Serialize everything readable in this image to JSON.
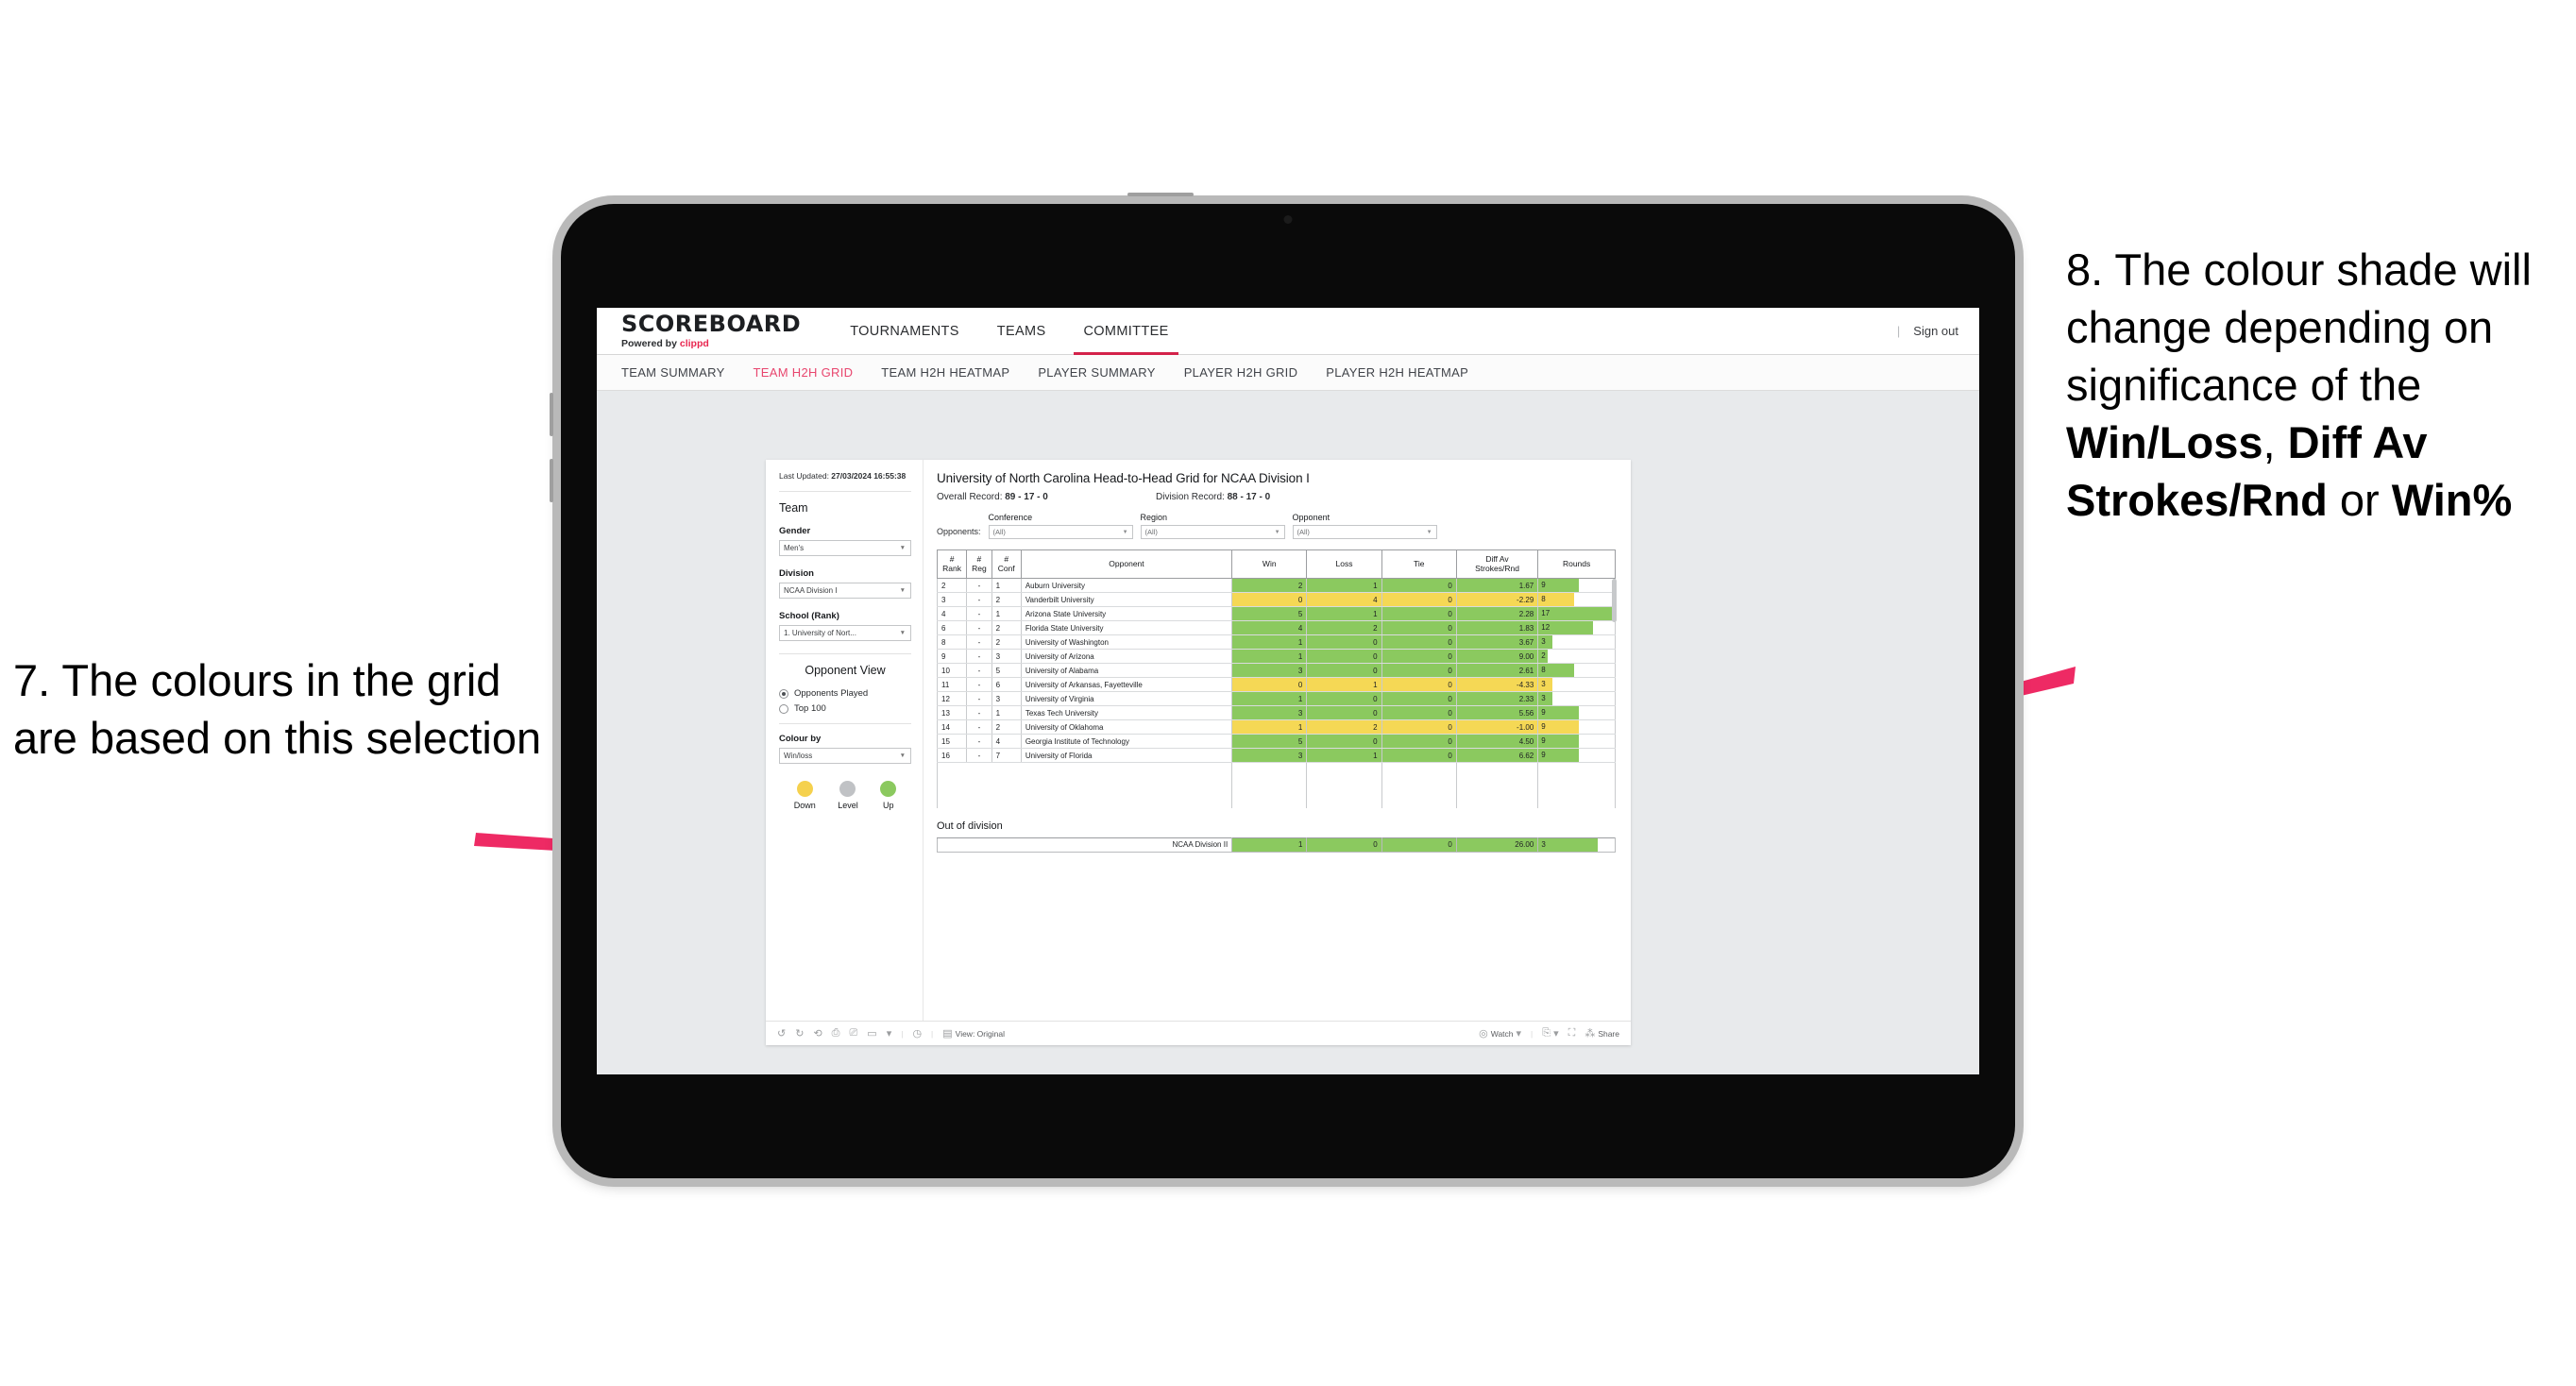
{
  "annotations": {
    "left": "7. The colours in the grid are based on this selection",
    "right_part1": "8. The colour shade will change depending on significance of the ",
    "right_bold1": "Win/Loss",
    "right_mid1": ", ",
    "right_bold2": "Diff Av Strokes/Rnd",
    "right_mid2": " or ",
    "right_bold3": "Win%",
    "arrow_color": "#ee2a64"
  },
  "app": {
    "logo": {
      "main": "SCOREBOARD",
      "sub_prefix": "Powered by ",
      "sub_brand": "clippd"
    },
    "nav": [
      {
        "label": "TOURNAMENTS",
        "active": false
      },
      {
        "label": "TEAMS",
        "active": false
      },
      {
        "label": "COMMITTEE",
        "active": true
      }
    ],
    "sign_out": "Sign out",
    "subnav": [
      {
        "label": "TEAM SUMMARY",
        "active": false
      },
      {
        "label": "TEAM H2H GRID",
        "active": true
      },
      {
        "label": "TEAM H2H HEATMAP",
        "active": false
      },
      {
        "label": "PLAYER SUMMARY",
        "active": false
      },
      {
        "label": "PLAYER H2H GRID",
        "active": false
      },
      {
        "label": "PLAYER H2H HEATMAP",
        "active": false
      }
    ]
  },
  "sidebar": {
    "last_updated_label": "Last Updated: ",
    "last_updated_value": "27/03/2024 16:55:38",
    "team_heading": "Team",
    "gender_label": "Gender",
    "gender_value": "Men's",
    "division_label": "Division",
    "division_value": "NCAA Division I",
    "school_label": "School (Rank)",
    "school_value": "1. University of Nort...",
    "opponent_view_heading": "Opponent View",
    "opponent_view_options": [
      {
        "label": "Opponents Played",
        "selected": true
      },
      {
        "label": "Top 100",
        "selected": false
      }
    ],
    "colour_by_label": "Colour by",
    "colour_by_value": "Win/loss",
    "legend": [
      {
        "label": "Down",
        "color": "#f5d14e"
      },
      {
        "label": "Level",
        "color": "#c0c2c5"
      },
      {
        "label": "Up",
        "color": "#8bc95f"
      }
    ]
  },
  "main": {
    "title": "University of North Carolina Head-to-Head Grid for NCAA Division I",
    "overall_record_label": "Overall Record: ",
    "overall_record_value": "89 - 17 - 0",
    "division_record_label": "Division Record: ",
    "division_record_value": "88 - 17 - 0",
    "opponents_label": "Opponents:",
    "filters": [
      {
        "caption": "Conference",
        "value": "(All)"
      },
      {
        "caption": "Region",
        "value": "(All)"
      },
      {
        "caption": "Opponent",
        "value": "(All)"
      }
    ],
    "columns": [
      "# Rank",
      "# Reg",
      "# Conf",
      "Opponent",
      "Win",
      "Loss",
      "Tie",
      "Diff Av Strokes/Rnd",
      "Rounds"
    ],
    "columns_split": [
      {
        "l1": "#",
        "l2": "Rank"
      },
      {
        "l1": "#",
        "l2": "Reg"
      },
      {
        "l1": "#",
        "l2": "Conf"
      },
      {
        "l1": "",
        "l2": "Opponent"
      },
      {
        "l1": "",
        "l2": "Win"
      },
      {
        "l1": "",
        "l2": "Loss"
      },
      {
        "l1": "",
        "l2": "Tie"
      },
      {
        "l1": "Diff Av",
        "l2": "Strokes/Rnd"
      },
      {
        "l1": "",
        "l2": "Rounds"
      }
    ],
    "rows": [
      {
        "rank": "2",
        "reg": "-",
        "conf": "1",
        "opponent": "Auburn University",
        "win": "2",
        "loss": "1",
        "tie": "0",
        "diff": "1.67",
        "rounds": "9",
        "status": "up"
      },
      {
        "rank": "3",
        "reg": "-",
        "conf": "2",
        "opponent": "Vanderbilt University",
        "win": "0",
        "loss": "4",
        "tie": "0",
        "diff": "-2.29",
        "rounds": "8",
        "status": "down"
      },
      {
        "rank": "4",
        "reg": "-",
        "conf": "1",
        "opponent": "Arizona State University",
        "win": "5",
        "loss": "1",
        "tie": "0",
        "diff": "2.28",
        "rounds": "17",
        "status": "up"
      },
      {
        "rank": "6",
        "reg": "-",
        "conf": "2",
        "opponent": "Florida State University",
        "win": "4",
        "loss": "2",
        "tie": "0",
        "diff": "1.83",
        "rounds": "12",
        "status": "up"
      },
      {
        "rank": "8",
        "reg": "-",
        "conf": "2",
        "opponent": "University of Washington",
        "win": "1",
        "loss": "0",
        "tie": "0",
        "diff": "3.67",
        "rounds": "3",
        "status": "up"
      },
      {
        "rank": "9",
        "reg": "-",
        "conf": "3",
        "opponent": "University of Arizona",
        "win": "1",
        "loss": "0",
        "tie": "0",
        "diff": "9.00",
        "rounds": "2",
        "status": "up"
      },
      {
        "rank": "10",
        "reg": "-",
        "conf": "5",
        "opponent": "University of Alabama",
        "win": "3",
        "loss": "0",
        "tie": "0",
        "diff": "2.61",
        "rounds": "8",
        "status": "up"
      },
      {
        "rank": "11",
        "reg": "-",
        "conf": "6",
        "opponent": "University of Arkansas, Fayetteville",
        "win": "0",
        "loss": "1",
        "tie": "0",
        "diff": "-4.33",
        "rounds": "3",
        "status": "down"
      },
      {
        "rank": "12",
        "reg": "-",
        "conf": "3",
        "opponent": "University of Virginia",
        "win": "1",
        "loss": "0",
        "tie": "0",
        "diff": "2.33",
        "rounds": "3",
        "status": "up"
      },
      {
        "rank": "13",
        "reg": "-",
        "conf": "1",
        "opponent": "Texas Tech University",
        "win": "3",
        "loss": "0",
        "tie": "0",
        "diff": "5.56",
        "rounds": "9",
        "status": "up"
      },
      {
        "rank": "14",
        "reg": "-",
        "conf": "2",
        "opponent": "University of Oklahoma",
        "win": "1",
        "loss": "2",
        "tie": "0",
        "diff": "-1.00",
        "rounds": "9",
        "status": "down"
      },
      {
        "rank": "15",
        "reg": "-",
        "conf": "4",
        "opponent": "Georgia Institute of Technology",
        "win": "5",
        "loss": "0",
        "tie": "0",
        "diff": "4.50",
        "rounds": "9",
        "status": "up"
      },
      {
        "rank": "16",
        "reg": "-",
        "conf": "7",
        "opponent": "University of Florida",
        "win": "3",
        "loss": "1",
        "tie": "0",
        "diff": "6.62",
        "rounds": "9",
        "status": "up"
      }
    ],
    "out_of_division_heading": "Out of division",
    "out_of_division_row": {
      "opponent": "NCAA Division II",
      "win": "1",
      "loss": "0",
      "tie": "0",
      "diff": "26.00",
      "rounds": "3",
      "status": "up"
    },
    "colors": {
      "up": "#8bc95f",
      "down": "#f5d855",
      "level": "#c0c2c5"
    }
  },
  "viz_footer": {
    "view_label": "View: Original",
    "watch_label": "Watch",
    "share_label": "Share"
  }
}
